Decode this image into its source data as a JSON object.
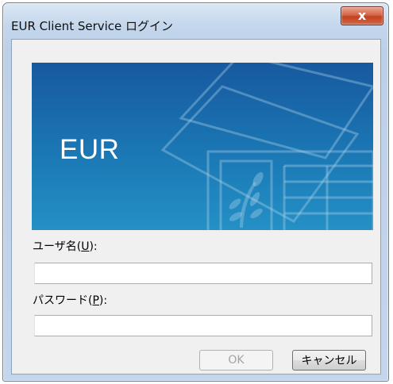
{
  "window": {
    "title": "EUR Client Service ログイン",
    "close_glyph": "x"
  },
  "banner": {
    "text": "EUR",
    "colors": {
      "top": "#17599f",
      "bottom": "#2490c6"
    }
  },
  "form": {
    "username_label_prefix": "ユーザ名(",
    "username_mnemonic": "U",
    "username_label_suffix": "):",
    "username_value": "",
    "password_label_prefix": "パスワード(",
    "password_mnemonic": "P",
    "password_label_suffix": "):",
    "password_value": ""
  },
  "buttons": {
    "ok_label": "OK",
    "ok_enabled": false,
    "cancel_label": "キャンセル"
  }
}
